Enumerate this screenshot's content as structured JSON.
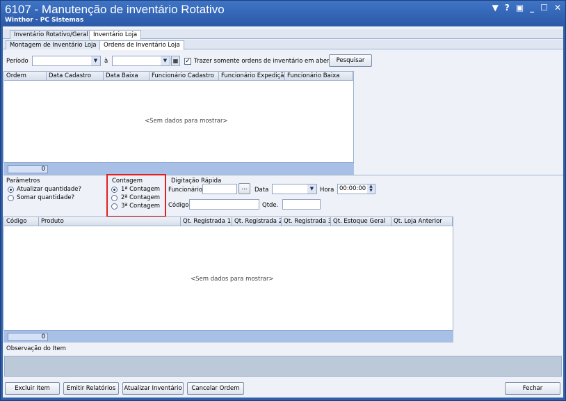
{
  "window": {
    "title": "6107 - Manutenção de inventário Rotativo",
    "subtitle": "Winthor - PC Sistemas",
    "buttons": [
      "▼",
      "?",
      "▣",
      "_",
      "☐",
      "✕"
    ]
  },
  "tabs_top": [
    "Inventário Rotativo/Geral",
    "Inventário Loja"
  ],
  "tabs_sub": [
    "Montagem de Inventário Loja",
    "Ordens de Inventário Loja"
  ],
  "filter": {
    "periodo_label": "Período",
    "a_label": "à",
    "checkbox_label": "Trazer somente ordens de inventário em aberto?",
    "pesquisar": "Pesquisar"
  },
  "grid1": {
    "columns": [
      "Ordem",
      "Data Cadastro",
      "Data Baixa",
      "Funcionário Cadastro",
      "Funcionário Expedição",
      "Funcionário Baixa"
    ],
    "empty": "<Sem dados para mostrar>",
    "count": "0"
  },
  "parametros": {
    "title": "Parâmetros",
    "options": [
      "Atualizar quantidade?",
      "Somar quantidade?"
    ]
  },
  "contagem": {
    "title": "Contagem",
    "options": [
      "1ª Contagem",
      "2ª Contagem",
      "3ª Contagem"
    ]
  },
  "digitacao": {
    "title": "Digitação Rápida",
    "funcionario": "Funcionário",
    "data": "Data",
    "hora": "Hora",
    "hora_value": "00:00:00",
    "codigo": "Código",
    "qtde": "Qtde.",
    "ellipsis": "..."
  },
  "grid2": {
    "columns": [
      "Código",
      "Produto",
      "Qt. Registrada 1",
      "Qt. Registrada 2",
      "Qt. Registrada 3",
      "Qt. Estoque Geral",
      "Qt. Loja Anterior"
    ],
    "empty": "<Sem dados para mostrar>",
    "count": "0"
  },
  "observacao": {
    "label": "Observação do Item"
  },
  "bottom_buttons": {
    "excluir": "Excluir Item",
    "emitir": "Emitir Relatórios",
    "atualizar": "Atualizar Inventário",
    "cancelar": "Cancelar Ordem",
    "fechar": "Fechar"
  },
  "colors": {
    "title_bar": "#2f5fa8",
    "highlight_box": "#e02020",
    "footer": "#a8bfe6"
  }
}
